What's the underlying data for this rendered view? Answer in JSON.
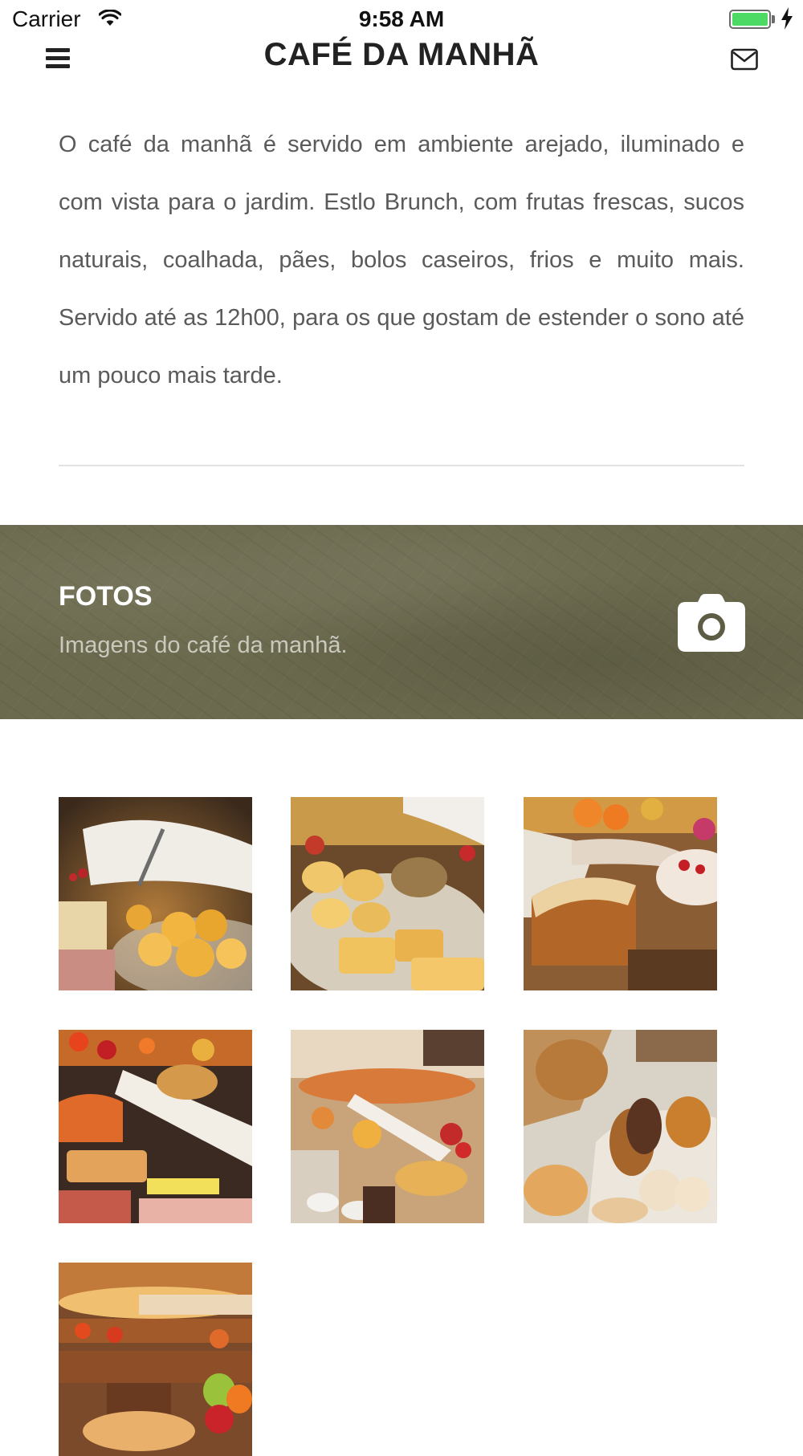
{
  "status_bar": {
    "carrier": "Carrier",
    "time": "9:58 AM",
    "battery_level": 1.0,
    "battery_color": "#4cd964",
    "icons": [
      "wifi-icon",
      "battery-icon",
      "charging-bolt-icon"
    ]
  },
  "nav": {
    "title": "CAFÉ DA MANHÃ",
    "menu_icon": "hamburger-menu-icon",
    "mail_icon": "mail-icon"
  },
  "content": {
    "description": "O café da manhã é servido em ambiente arejado, iluminado e com vista para o jardim. Estlo Brunch, com frutas frescas, sucos naturais, coalhada, pães, bolos caseiros, frios e muito mais. Servido até as 12h00, para os que gostam de estender o sono até um pouco mais tarde."
  },
  "banner": {
    "title": "FOTOS",
    "subtitle": "Imagens do café da manhã.",
    "icon": "camera-icon",
    "background_color": "#6b6a4e"
  },
  "gallery": {
    "photos": [
      {
        "name": "photo-breads-basket"
      },
      {
        "name": "photo-pastries-tray"
      },
      {
        "name": "photo-cake-fruit"
      },
      {
        "name": "photo-buffet-table"
      },
      {
        "name": "photo-buffet-overview"
      },
      {
        "name": "photo-eclairs-breads"
      },
      {
        "name": "photo-fruit-buffet"
      }
    ]
  }
}
